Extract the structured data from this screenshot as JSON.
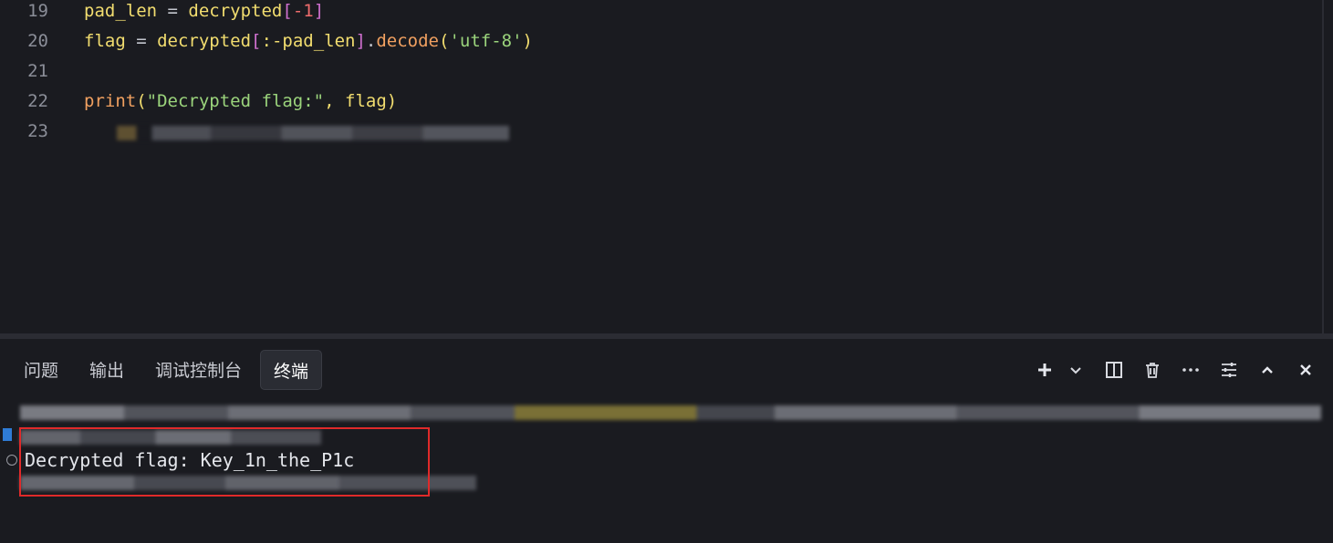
{
  "editor": {
    "lines": [
      {
        "num": "19"
      },
      {
        "num": "20"
      },
      {
        "num": "21"
      },
      {
        "num": "22"
      },
      {
        "num": "23"
      }
    ],
    "tokens": {
      "l19_a": "pad_len",
      "l19_b": " = ",
      "l19_c": "decrypted",
      "l19_d": "[",
      "l19_e": "-1",
      "l19_f": "]",
      "l20_a": "flag",
      "l20_b": " = ",
      "l20_c": "decrypted",
      "l20_d": "[",
      "l20_e": ":-pad_len",
      "l20_f": "]",
      "l20_g": ".",
      "l20_h": "decode",
      "l20_i": "(",
      "l20_j": "'utf-8'",
      "l20_k": ")",
      "l22_a": "print",
      "l22_b": "(",
      "l22_c": "\"Decrypted flag:\"",
      "l22_d": ", flag",
      "l22_e": ")"
    }
  },
  "panel": {
    "tabs": [
      "问题",
      "输出",
      "调试控制台",
      "终端"
    ],
    "active_tab": "终端",
    "actions": {
      "add": "+",
      "dropdown": "⌄",
      "split": "◫",
      "trash": "🗑",
      "more": "···",
      "settings": "⚙",
      "maximize": "∧",
      "close": "×"
    }
  },
  "terminal": {
    "output_line": "Decrypted flag: Key_1n_the_P1c"
  },
  "colors": {
    "background": "#1a1b20",
    "highlight_box": "#e02a2a",
    "active_tab_bg": "#2a2c33"
  }
}
